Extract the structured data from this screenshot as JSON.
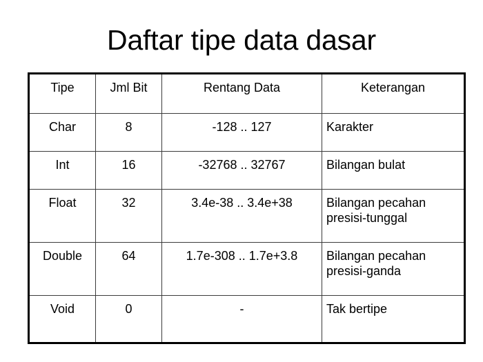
{
  "slide": {
    "title": "Daftar tipe data dasar",
    "background_color": "#ffffff",
    "text_color": "#000000",
    "border_color": "#000000"
  },
  "table": {
    "headers": {
      "tipe": "Tipe",
      "jml_bit": "Jml Bit",
      "rentang_data": "Rentang Data",
      "keterangan": "Keterangan"
    },
    "rows": [
      {
        "tipe": "Char",
        "jml_bit": "8",
        "rentang_data": "-128 .. 127",
        "keterangan": "Karakter"
      },
      {
        "tipe": "Int",
        "jml_bit": "16",
        "rentang_data": "-32768 .. 32767",
        "keterangan": "Bilangan bulat"
      },
      {
        "tipe": "Float",
        "jml_bit": "32",
        "rentang_data": "3.4e-38 .. 3.4e+38",
        "keterangan": "Bilangan pecahan\npresisi-tunggal"
      },
      {
        "tipe": "Double",
        "jml_bit": "64",
        "rentang_data": "1.7e-308 .. 1.7e+3.8",
        "keterangan": "Bilangan pecahan\npresisi-ganda"
      },
      {
        "tipe": "Void",
        "jml_bit": "0",
        "rentang_data": "-",
        "keterangan": "Tak bertipe"
      }
    ]
  }
}
